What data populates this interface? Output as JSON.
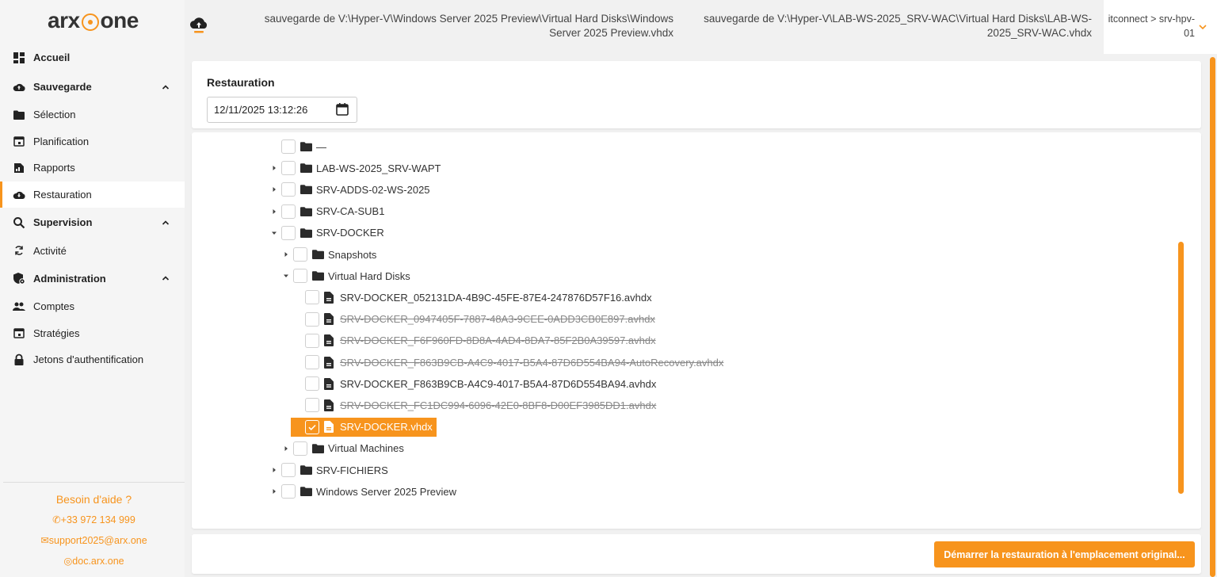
{
  "brand": {
    "logo_left": "arx",
    "logo_right": "one",
    "accent": "#f7941d"
  },
  "sidebar": {
    "items": [
      {
        "label": "Accueil",
        "icon": "dashboard-icon",
        "type": "section"
      },
      {
        "label": "Sauvegarde",
        "icon": "cloud-upload-icon",
        "type": "section",
        "expanded": true
      },
      {
        "label": "Sélection",
        "icon": "folder-icon",
        "type": "sub"
      },
      {
        "label": "Planification",
        "icon": "calendar-icon",
        "type": "sub"
      },
      {
        "label": "Rapports",
        "icon": "report-icon",
        "type": "sub"
      },
      {
        "label": "Restauration",
        "icon": "cloud-download-icon",
        "type": "sub",
        "active": true
      },
      {
        "label": "Supervision",
        "icon": "search-icon",
        "type": "section",
        "expanded": true
      },
      {
        "label": "Activité",
        "icon": "refresh-icon",
        "type": "sub"
      },
      {
        "label": "Administration",
        "icon": "shield-gear-icon",
        "type": "section",
        "expanded": true
      },
      {
        "label": "Comptes",
        "icon": "users-icon",
        "type": "sub"
      },
      {
        "label": "Stratégies",
        "icon": "calendar-icon",
        "type": "sub"
      },
      {
        "label": "Jetons d'authentification",
        "icon": "lock-icon",
        "type": "sub"
      }
    ],
    "help": {
      "title": "Besoin d'aide ?",
      "phone": "+33 972 134 999",
      "email": "support2025@arx.one",
      "doc": "doc.arx.one"
    }
  },
  "header": {
    "crumb1": "sauvegarde de V:\\Hyper-V\\Windows Server 2025 Preview\\Virtual Hard Disks\\Windows Server 2025 Preview.vhdx",
    "crumb2": "sauvegarde de V:\\Hyper-V\\LAB-WS-2025_SRV-WAC\\Virtual Hard Disks\\LAB-WS-2025_SRV-WAC.vhdx",
    "account": "itconnect > srv-hpv-01"
  },
  "restore": {
    "title": "Restauration",
    "date_value": "12/11/2025 13:12:26"
  },
  "tree": {
    "rows": [
      {
        "label": "—",
        "type": "folder",
        "depth": 0,
        "toggle": "none",
        "checked": false,
        "strike": false
      },
      {
        "label": "LAB-WS-2025_SRV-WAPT",
        "type": "folder",
        "depth": 0,
        "toggle": "collapsed",
        "checked": false,
        "strike": false
      },
      {
        "label": "SRV-ADDS-02-WS-2025",
        "type": "folder",
        "depth": 0,
        "toggle": "collapsed",
        "checked": false,
        "strike": false
      },
      {
        "label": "SRV-CA-SUB1",
        "type": "folder",
        "depth": 0,
        "toggle": "collapsed",
        "checked": false,
        "strike": false
      },
      {
        "label": "SRV-DOCKER",
        "type": "folder",
        "depth": 0,
        "toggle": "expanded",
        "checked": false,
        "strike": false
      },
      {
        "label": "Snapshots",
        "type": "folder",
        "depth": 1,
        "toggle": "collapsed",
        "checked": false,
        "strike": false
      },
      {
        "label": "Virtual Hard Disks",
        "type": "folder",
        "depth": 1,
        "toggle": "expanded",
        "checked": false,
        "strike": false
      },
      {
        "label": "SRV-DOCKER_052131DA-4B9C-45FE-87E4-247876D57F16.avhdx",
        "type": "file",
        "depth": 2,
        "toggle": "none",
        "checked": false,
        "strike": false
      },
      {
        "label": "SRV-DOCKER_0947405F-7887-48A3-9CEE-0ADD3CB0E897.avhdx",
        "type": "file",
        "depth": 2,
        "toggle": "none",
        "checked": false,
        "strike": true
      },
      {
        "label": "SRV-DOCKER_F6F960FD-8D8A-4AD4-8DA7-85F2B0A39597.avhdx",
        "type": "file",
        "depth": 2,
        "toggle": "none",
        "checked": false,
        "strike": true
      },
      {
        "label": "SRV-DOCKER_F863B9CB-A4C9-4017-B5A4-87D6D554BA94-AutoRecovery.avhdx",
        "type": "file",
        "depth": 2,
        "toggle": "none",
        "checked": false,
        "strike": true
      },
      {
        "label": "SRV-DOCKER_F863B9CB-A4C9-4017-B5A4-87D6D554BA94.avhdx",
        "type": "file",
        "depth": 2,
        "toggle": "none",
        "checked": false,
        "strike": false
      },
      {
        "label": "SRV-DOCKER_FC1DC994-6096-42E0-8BF8-D00EF3985DD1.avhdx",
        "type": "file",
        "depth": 2,
        "toggle": "none",
        "checked": false,
        "strike": true
      },
      {
        "label": "SRV-DOCKER.vhdx",
        "type": "file",
        "depth": 2,
        "toggle": "none",
        "checked": true,
        "strike": false,
        "selected": true
      },
      {
        "label": "Virtual Machines",
        "type": "folder",
        "depth": 1,
        "toggle": "collapsed",
        "checked": false,
        "strike": false
      },
      {
        "label": "SRV-FICHIERS",
        "type": "folder",
        "depth": 0,
        "toggle": "collapsed",
        "checked": false,
        "strike": false
      },
      {
        "label": "Windows Server 2025 Preview",
        "type": "folder",
        "depth": 0,
        "toggle": "collapsed",
        "checked": false,
        "strike": false
      }
    ]
  },
  "footer": {
    "restore_button": "Démarrer la restauration à l'emplacement original..."
  }
}
